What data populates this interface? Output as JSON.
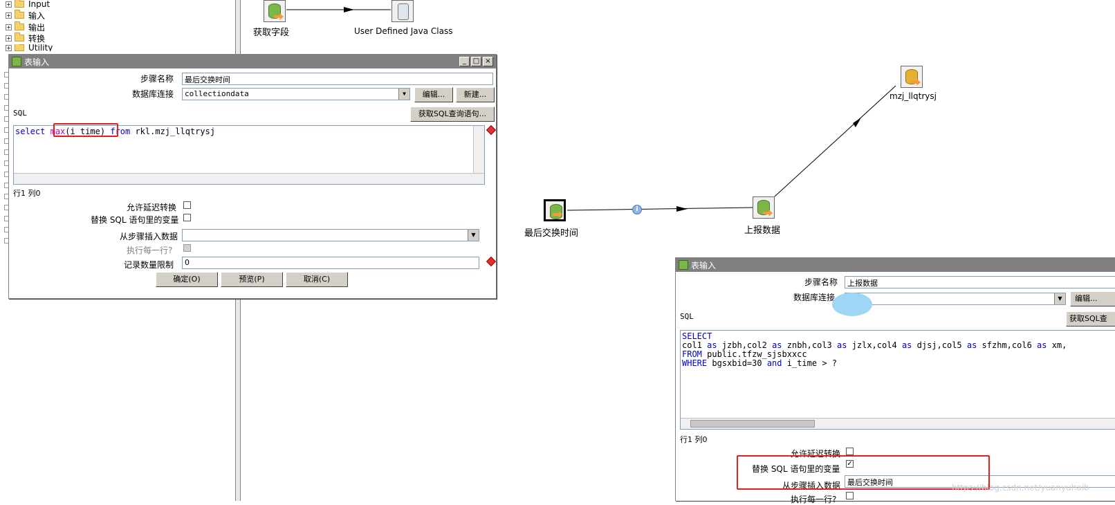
{
  "tree": {
    "items": [
      "Input",
      "输入",
      "输出",
      "转换",
      "Utility"
    ]
  },
  "canvas": {
    "steps": {
      "get_fields": "获取字段",
      "udjc": "User Defined Java Class",
      "last_exchange": "最后交换时间",
      "report_data": "上报数据",
      "output_table": "mzj_llqtrysj"
    }
  },
  "dialog1": {
    "title": "表输入",
    "step_name_label": "步骤名称",
    "step_name_value": "最后交换时间",
    "db_conn_label": "数据库连接",
    "db_conn_value": "collectiondata",
    "edit_button": "编辑...",
    "new_button": "新建...",
    "sql_label": "SQL",
    "get_sql_button": "获取SQL查询语句...",
    "sql": {
      "kw1": "select",
      "fn": "max",
      "args": "(i_time)",
      "kw2": "from",
      "rest": "rkl.mzj_llqtrysj"
    },
    "position_text": "行1 列0",
    "lazy_conversion_label": "允许延迟转换",
    "replace_vars_label": "替换 SQL 语句里的变量",
    "insert_from_step_label": "从步骤插入数据",
    "insert_from_step_value": "",
    "execute_each_row_label": "执行每一行?",
    "limit_label": "记录数量限制",
    "limit_value": "0",
    "ok_button": "确定(O)",
    "preview_button": "预览(P)",
    "cancel_button": "取消(C)"
  },
  "dialog2": {
    "title": "表输入",
    "step_name_label": "步骤名称",
    "step_name_value": "上报数据",
    "db_conn_label": "数据库连接",
    "db_conn_value": "",
    "edit_button": "编辑...",
    "sql_label": "SQL",
    "get_sql_button": "获取SQL查",
    "sql_lines": {
      "l1_kw": "SELECT",
      "l2_a": "col1 ",
      "l2_as1": "as",
      "l2_b": " jzbh,col2 ",
      "l2_as2": "as",
      "l2_c": " znbh,col3 ",
      "l2_as3": "as",
      "l2_d": " jzlx,col4 ",
      "l2_as4": "as",
      "l2_e": " djsj,col5 ",
      "l2_as5": "as",
      "l2_f": " sfzhm,col6 ",
      "l2_as6": "as",
      "l2_g": " xm,",
      "l3_kw": "FROM",
      "l3_rest": " public.tfzw_sjsbxxcc",
      "l4_kw": "WHERE",
      "l4_a": " bgsxbid=30 ",
      "l4_and": "and",
      "l4_b": " i_time > ?"
    },
    "position_text": "行1 列0",
    "lazy_conversion_label": "允许延迟转换",
    "replace_vars_label": "替换 SQL 语句里的变量",
    "replace_vars_checked": true,
    "insert_from_step_label": "从步骤插入数据",
    "insert_from_step_value": "最后交换时间",
    "execute_each_row_label": "执行每一行?"
  },
  "watermark": "https://blog.csdn.net/yuanyuhaib",
  "colors": {
    "keyword": "#0000c0",
    "function": "#c000c0",
    "highlight": "#e02020",
    "titlebar": "#808080"
  }
}
